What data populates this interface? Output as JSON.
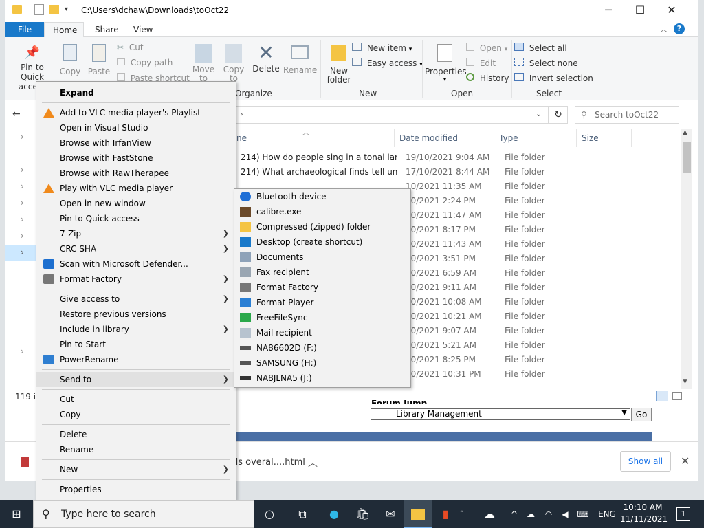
{
  "window": {
    "title_path": "C:\\Users\\dchaw\\Downloads\\toOct22",
    "minimize": "─",
    "maximize": "☐",
    "close": "✕"
  },
  "ribbon": {
    "tabs": [
      "File",
      "Home",
      "Share",
      "View"
    ],
    "pin_to_quick_access": "Pin to Quick\naccess",
    "copy": "Copy",
    "paste": "Paste",
    "cut": "Cut",
    "copy_path": "Copy path",
    "paste_shortcut": "Paste shortcut",
    "move_to": "Move\nto",
    "copy_to": "Copy\nto",
    "delete": "Delete",
    "rename": "Rename",
    "organize_label": "Organize",
    "new_folder": "New\nfolder",
    "new_item": "New item",
    "easy_access": "Easy access",
    "new_label": "New",
    "properties": "Properties",
    "open": "Open",
    "edit": "Edit",
    "history": "History",
    "open_label": "Open",
    "select_all": "Select all",
    "select_none": "Select none",
    "invert_selection": "Invert selection",
    "select_label": "Select"
  },
  "navbar": {
    "search_placeholder": "Search toOct22"
  },
  "file_list": {
    "columns": [
      "ne",
      "Date modified",
      "Type",
      "Size"
    ],
    "rows": [
      {
        "name": "214) How do people sing in a tonal lang...",
        "date": "19/10/2021 9:04 AM",
        "type": "File folder"
      },
      {
        "name": "214) What archaeological finds tell unbe...",
        "date": "17/10/2021 8:44 AM",
        "type": "File folder"
      },
      {
        "name": "",
        "date": "10/2021 11:35 AM",
        "type": "File folder"
      },
      {
        "name": "",
        "date": "10/2021 2:24 PM",
        "type": "File folder"
      },
      {
        "name": "",
        "date": "10/2021 11:47 AM",
        "type": "File folder"
      },
      {
        "name": "",
        "date": "10/2021 8:17 PM",
        "type": "File folder"
      },
      {
        "name": "",
        "date": "10/2021 11:43 AM",
        "type": "File folder"
      },
      {
        "name": "",
        "date": "10/2021 3:51 PM",
        "type": "File folder"
      },
      {
        "name": "",
        "date": "10/2021 6:59 AM",
        "type": "File folder"
      },
      {
        "name": "",
        "date": "10/2021 9:11 AM",
        "type": "File folder"
      },
      {
        "name": "",
        "date": "10/2021 10:08 AM",
        "type": "File folder"
      },
      {
        "name": "",
        "date": "10/2021 10:21 AM",
        "type": "File folder"
      },
      {
        "name": "",
        "date": "10/2021 9:07 AM",
        "type": "File folder"
      },
      {
        "name": "",
        "date": "10/2021 5:21 AM",
        "type": "File folder"
      },
      {
        "name": "",
        "date": "10/2021 8:25 PM",
        "type": "File folder"
      },
      {
        "name": "",
        "date": "10/2021 10:31 PM",
        "type": "File folder"
      }
    ],
    "item_count": "119 it"
  },
  "context_menu": {
    "items": [
      "Expand",
      "Add to VLC media player's Playlist",
      "Open in Visual Studio",
      "Browse with IrfanView",
      "Browse with FastStone",
      "Browse with RawTherapee",
      "Play with VLC media player",
      "Open in new window",
      "Pin to Quick access",
      "7-Zip",
      "CRC SHA",
      "Scan with Microsoft Defender...",
      "Format Factory",
      "Give access to",
      "Restore previous versions",
      "Include in library",
      "Pin to Start",
      "PowerRename",
      "Send to",
      "Cut",
      "Copy",
      "Delete",
      "Rename",
      "New",
      "Properties"
    ]
  },
  "send_to": {
    "items": [
      "Bluetooth device",
      "calibre.exe",
      "Compressed (zipped) folder",
      "Desktop (create shortcut)",
      "Documents",
      "Fax recipient",
      "Format Factory",
      "Format Player",
      "FreeFileSync",
      "Mail recipient",
      "NA86602D (F:)",
      "SAMSUNG (H:)",
      "NA8JLNA5 (J:)"
    ]
  },
  "browser": {
    "forum_jump": "Forum Jump",
    "select_value": "Library Management",
    "go": "Go",
    "download_name": "ds overal....html",
    "show_all": "Show all"
  },
  "taskbar": {
    "search_placeholder": "Type here to search",
    "language": "ENG",
    "time": "10:10 AM",
    "date": "11/11/2021",
    "notification_count": "1"
  },
  "colors": {
    "file_tab": "#1979ca",
    "taskbar": "#202b37",
    "folder": "#f4c443"
  }
}
